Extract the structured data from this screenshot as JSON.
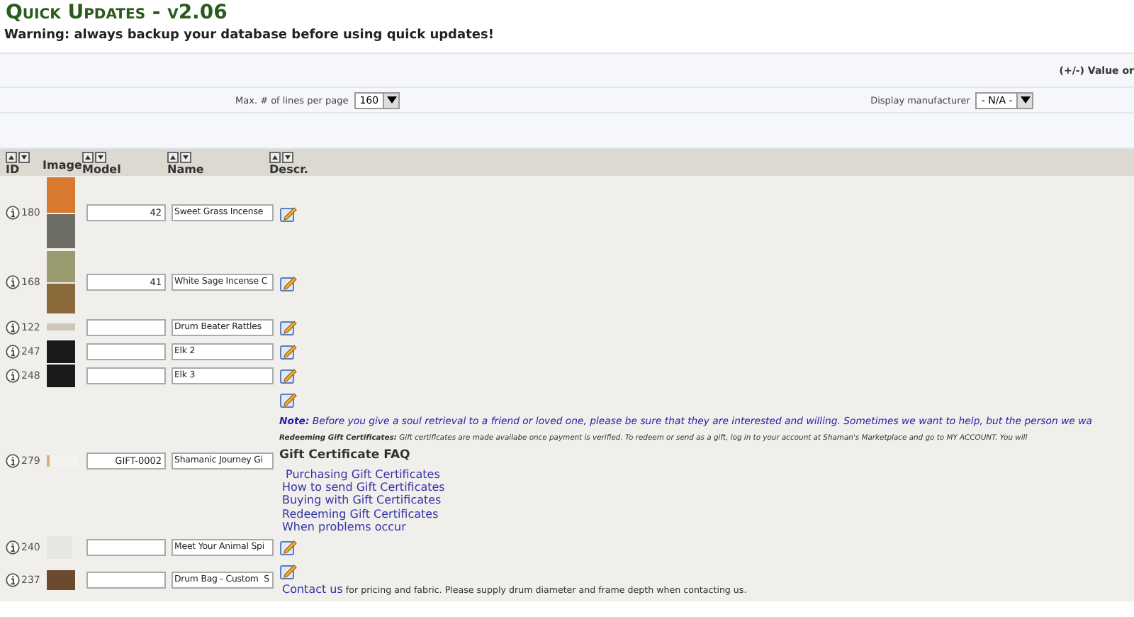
{
  "title": "Quick Updates - v2.06",
  "warning": "Warning: always backup your database before using quick updates!",
  "value_hint": "(+/-) Value or",
  "lines_per_page": {
    "label": "Max. # of lines per page",
    "value": "160"
  },
  "manufacturer": {
    "label": "Display manufacturer",
    "value": "- N/A -"
  },
  "columns": [
    {
      "label": "ID",
      "sortable": true
    },
    {
      "label": "Image",
      "sortable": false
    },
    {
      "label": "Model",
      "sortable": true
    },
    {
      "label": "Name",
      "sortable": true
    },
    {
      "label": "Descr.",
      "sortable": true
    }
  ],
  "rows": [
    {
      "id": "180",
      "thumb": {
        "kind": "double"
      },
      "model": "42",
      "name": "Sweet Grass Incense",
      "descr": [
        {
          "kind": "edit"
        }
      ]
    },
    {
      "id": "168",
      "thumb": {
        "kind": "double-sage"
      },
      "model": "41",
      "name": "White Sage Incense C",
      "descr": [
        {
          "kind": "edit"
        }
      ]
    },
    {
      "id": "122",
      "thumb": {
        "kind": "strip"
      },
      "model": "",
      "name": "Drum Beater Rattles",
      "descr": [
        {
          "kind": "edit"
        }
      ]
    },
    {
      "id": "247",
      "thumb": {
        "kind": "round"
      },
      "model": "",
      "name": "Elk 2",
      "descr": [
        {
          "kind": "edit"
        }
      ]
    },
    {
      "id": "248",
      "thumb": {
        "kind": "round"
      },
      "model": "",
      "name": "Elk 3",
      "descr": [
        {
          "kind": "edit"
        }
      ]
    },
    {
      "id": "279",
      "thumb": {
        "kind": "blank"
      },
      "model": "GIFT-0002",
      "name": "Shamanic Journey Gi",
      "descr": [
        {
          "kind": "edit"
        },
        {
          "kind": "note",
          "text": "**Note:** Before you give a soul retrieval to a friend or loved one, please be sure that they are interested and willing. Sometimes we want to help, but the person we wa"
        },
        {
          "kind": "redeem",
          "text": "**Redeeming Gift Certificates:** Gift certificates are made availabe once payment is verified. To redeem or send as a gift, log in to your account at Shaman's Marketplace and go to MY ACCOUNT. You will"
        },
        {
          "kind": "heading",
          "text": "Gift Certificate FAQ"
        },
        {
          "kind": "links",
          "items": [
            " Purchasing Gift Certificates",
            "How to send Gift Certificates",
            "Buying with Gift Certificates",
            "Redeeming Gift Certificates",
            "When problems occur"
          ]
        }
      ]
    },
    {
      "id": "240",
      "thumb": {
        "kind": "logo"
      },
      "model": "",
      "name": "Meet Your Animal Spi",
      "descr": [
        {
          "kind": "edit"
        }
      ]
    },
    {
      "id": "237",
      "thumb": {
        "kind": "bag"
      },
      "model": "",
      "name": "Drum Bag - Custom  S",
      "descr": [
        {
          "kind": "edit"
        },
        {
          "kind": "contact",
          "link": "Contact us",
          "text": " for pricing and fabric. Please supply drum diameter and frame depth when contacting us."
        }
      ]
    }
  ]
}
